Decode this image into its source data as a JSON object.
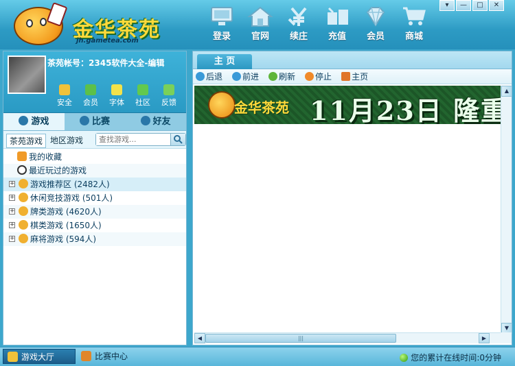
{
  "header": {
    "logo_text": "金华茶苑",
    "logo_url": "jh.gametea.com",
    "nav": [
      {
        "label": "登录",
        "icon": "monitor-icon"
      },
      {
        "label": "官网",
        "icon": "house-icon"
      },
      {
        "label": "续庄",
        "icon": "yen-icon"
      },
      {
        "label": "充值",
        "icon": "recharge-icon"
      },
      {
        "label": "会员",
        "icon": "diamond-icon"
      },
      {
        "label": "商城",
        "icon": "cart-icon"
      }
    ],
    "window": {
      "menu": "▾",
      "minimize": "—",
      "maximize": "□",
      "close": "✕"
    }
  },
  "user": {
    "account_label": "茶苑帐号：",
    "account_value": "2345软件大全-编辑",
    "tools": [
      {
        "label": "安全",
        "color": "#f0c23a"
      },
      {
        "label": "会员",
        "color": "#5cc04a"
      },
      {
        "label": "字体",
        "color": "#f3e24a"
      },
      {
        "label": "社区",
        "color": "#62c94e"
      },
      {
        "label": "反馈",
        "color": "#7ad05a"
      }
    ]
  },
  "tabs": [
    {
      "label": "游戏",
      "active": true
    },
    {
      "label": "比赛",
      "active": false
    },
    {
      "label": "好友",
      "active": false
    }
  ],
  "subtabs": {
    "items": [
      "茶苑游戏",
      "地区游戏"
    ],
    "search_placeholder": "查找游戏..."
  },
  "tree": [
    {
      "label": "我的收藏",
      "kind": "fav"
    },
    {
      "label": "最近玩过的游戏",
      "kind": "recent"
    },
    {
      "label": "游戏推荐区 (2482人)",
      "kind": "group"
    },
    {
      "label": "休闲竞技游戏 (501人)",
      "kind": "group"
    },
    {
      "label": "牌类游戏 (4620人)",
      "kind": "group"
    },
    {
      "label": "棋类游戏 (1650人)",
      "kind": "group"
    },
    {
      "label": "麻将游戏 (594人)",
      "kind": "group"
    }
  ],
  "right": {
    "tab": "主 页",
    "toolbar": [
      {
        "label": "后退",
        "color": "#3a9ad8"
      },
      {
        "label": "前进",
        "color": "#3a9ad8"
      },
      {
        "label": "刷新",
        "color": "#5fb53a"
      },
      {
        "label": "停止",
        "color": "#f08a2a"
      },
      {
        "label": "主页",
        "color": "#e0762a"
      }
    ],
    "banner_logo": "金华茶苑",
    "banner_text": "11月23日 隆重"
  },
  "status": {
    "hall": "游戏大厅",
    "match_center": "比赛中心",
    "online_text": "您的累计在线时间",
    "online_value": ":0分钟"
  }
}
